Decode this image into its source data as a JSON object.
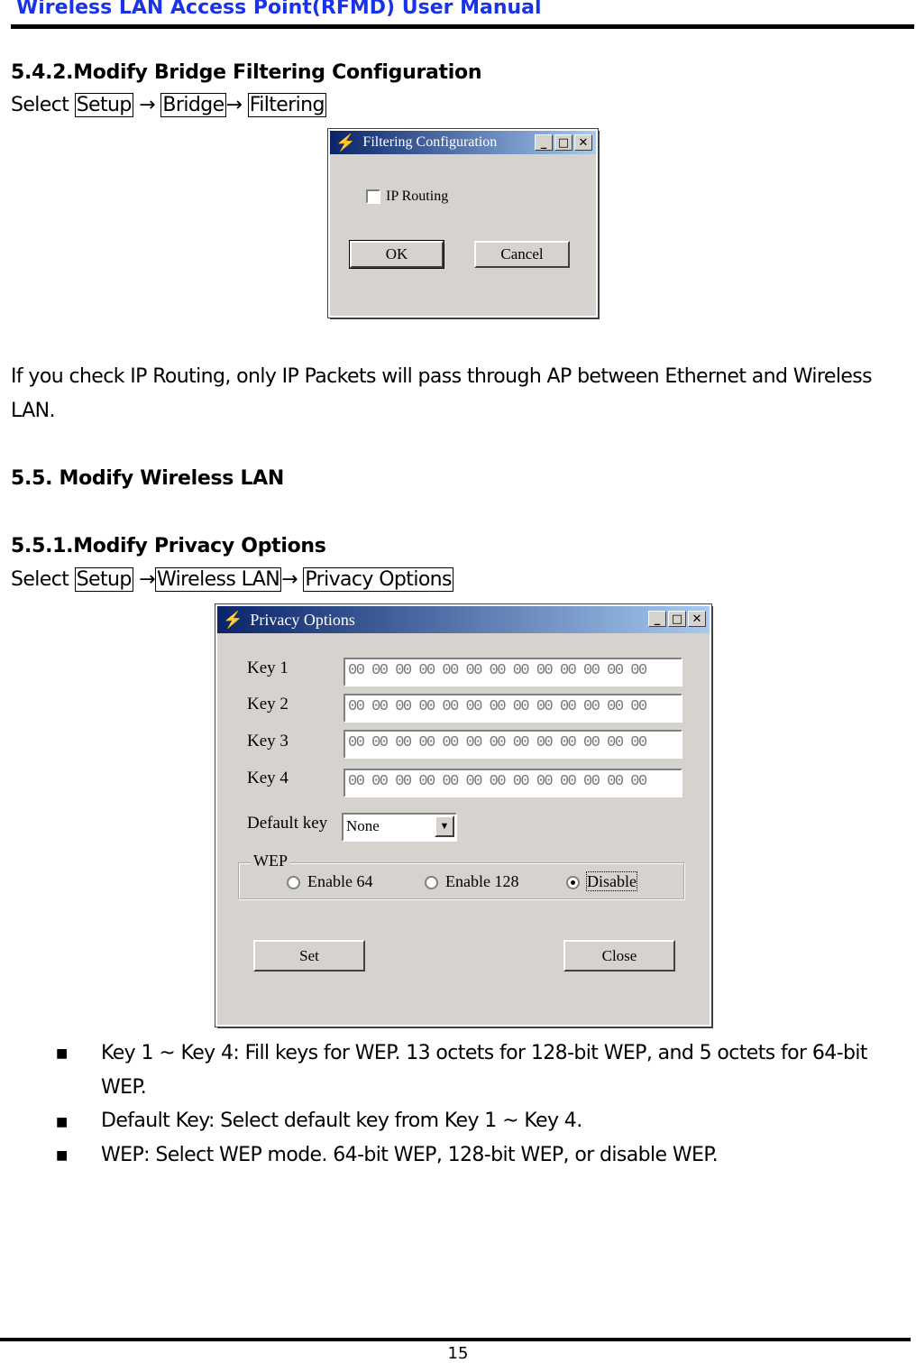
{
  "header": {
    "title": "Wireless LAN Access Point(RFMD) User Manual"
  },
  "s542": {
    "heading": "5.4.2.Modify Bridge Filtering Configuration",
    "select": "Select",
    "path": [
      "Setup",
      "Bridge",
      "Filtering"
    ],
    "arrow": "→"
  },
  "filter_dialog": {
    "title": "Filtering Configuration",
    "ip_routing": "IP Routing",
    "ip_routing_checked": false,
    "ok": "OK",
    "cancel": "Cancel"
  },
  "para1": "If you check IP Routing, only IP Packets will pass through AP between Ethernet and Wireless",
  "para1b": "LAN.",
  "s55": {
    "heading": "5.5.  Modify Wireless LAN"
  },
  "s551": {
    "heading": "5.5.1.Modify Privacy Options",
    "select": "Select",
    "path": [
      "Setup",
      "Wireless LAN",
      "Privacy Options"
    ],
    "arrow": "→"
  },
  "privacy_dialog": {
    "title": "Privacy Options",
    "keys": [
      {
        "label": "Key 1",
        "value": "00 00 00 00 00 00 00 00 00 00 00 00 00"
      },
      {
        "label": "Key 2",
        "value": "00 00 00 00 00 00 00 00 00 00 00 00 00"
      },
      {
        "label": "Key 3",
        "value": "00 00 00 00 00 00 00 00 00 00 00 00 00"
      },
      {
        "label": "Key 4",
        "value": "00 00 00 00 00 00 00 00 00 00 00 00 00"
      }
    ],
    "default_key_label": "Default key",
    "default_key_value": "None",
    "wep_label": "WEP",
    "wep_options": [
      "Enable 64",
      "Enable 128",
      "Disable"
    ],
    "wep_selected": "Disable",
    "set": "Set",
    "close": "Close"
  },
  "bullets": [
    "Key 1 ~ Key 4: Fill keys for WEP. 13 octets for 128-bit WEP, and 5 octets for 64-bit",
    "WEP.",
    "Default Key: Select default key from Key 1 ~ Key 4.",
    "WEP: Select WEP mode. 64-bit WEP, 128-bit WEP, or disable WEP."
  ],
  "footer": {
    "page": "15"
  }
}
